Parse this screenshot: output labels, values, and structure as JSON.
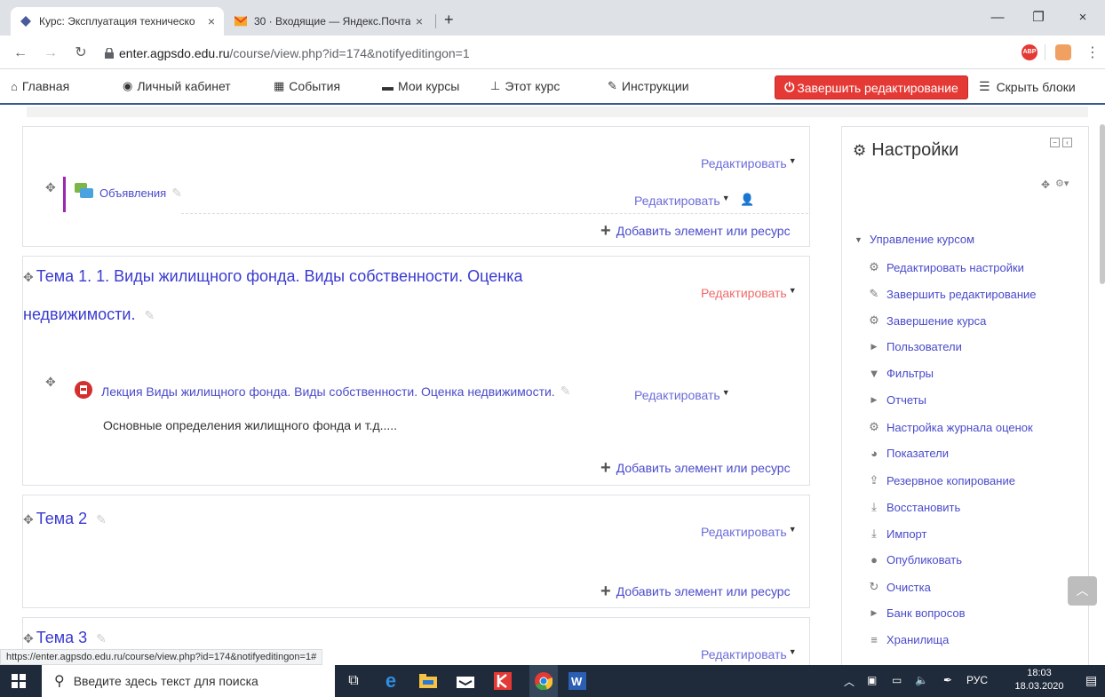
{
  "browser": {
    "tabs": [
      {
        "label": "Курс: Эксплуатация техническо",
        "close": "×"
      },
      {
        "label": "30 · Входящие — Яндекс.Почта",
        "close": "×"
      }
    ],
    "new_tab": "+",
    "window_controls": {
      "minimize": "—",
      "restore": "❐",
      "close": "×"
    },
    "url_host": "enter.agpsdo.edu.ru",
    "url_path": "/course/view.php?id=174&notifyeditingon=1",
    "abp_label": "ABP"
  },
  "navbar": {
    "items": [
      {
        "label": "Главная",
        "icon": "home-icon"
      },
      {
        "label": "Личный кабинет",
        "icon": "dashboard-icon"
      },
      {
        "label": "События",
        "icon": "calendar-icon"
      },
      {
        "label": "Мои курсы",
        "icon": "briefcase-icon"
      },
      {
        "label": "Этот курс",
        "icon": "sitemap-icon"
      },
      {
        "label": "Инструкции",
        "icon": "wrench-icon"
      }
    ],
    "finish_editing": "Завершить редактирование",
    "hide_blocks": "Скрыть блоки"
  },
  "sections": [
    {
      "edit": "Редактировать",
      "activity": {
        "name": "Объявления",
        "edit": "Редактировать"
      },
      "add": "Добавить элемент или ресурс"
    },
    {
      "title_line1": "Тема 1. 1. Виды жилищного фонда. Виды собственности. Оценка",
      "title_line2": "недвижимости.",
      "edit": "Редактировать",
      "activity": {
        "name": "Лекция Виды жилищного фонда. Виды собственности. Оценка недвижимости.",
        "edit": "Редактировать",
        "description": "Основные определения жилищного фонда  и т.д....."
      },
      "add": "Добавить элемент или ресурс"
    },
    {
      "title": "Тема 2",
      "edit": "Редактировать",
      "add": "Добавить элемент или ресурс"
    },
    {
      "title": "Тема 3",
      "edit": "Редактировать"
    }
  ],
  "settings": {
    "title": "Настройки",
    "group": "Управление курсом",
    "items": [
      {
        "label": "Редактировать настройки",
        "icon": "gear-icon"
      },
      {
        "label": "Завершить редактирование",
        "icon": "pencil-icon"
      },
      {
        "label": "Завершение курса",
        "icon": "gear-icon"
      },
      {
        "label": "Пользователи",
        "icon": "triangle-icon"
      },
      {
        "label": "Фильтры",
        "icon": "filter-icon"
      },
      {
        "label": "Отчеты",
        "icon": "triangle-icon"
      },
      {
        "label": "Настройка журнала оценок",
        "icon": "gear-icon"
      },
      {
        "label": "Показатели",
        "icon": "pie-icon"
      },
      {
        "label": "Резервное копирование",
        "icon": "upload-icon"
      },
      {
        "label": "Восстановить",
        "icon": "download-icon"
      },
      {
        "label": "Импорт",
        "icon": "download-icon"
      },
      {
        "label": "Опубликовать",
        "icon": "globe-icon"
      },
      {
        "label": "Очистка",
        "icon": "refresh-icon"
      },
      {
        "label": "Банк вопросов",
        "icon": "triangle-icon"
      },
      {
        "label": "Хранилища",
        "icon": "database-icon"
      }
    ]
  },
  "status_url": "https://enter.agpsdo.edu.ru/course/view.php?id=174&notifyeditingon=1#",
  "taskbar": {
    "search_placeholder": "Введите здесь текст для поиска",
    "lang": "РУС",
    "time": "18:03",
    "date": "18.03.2020"
  }
}
